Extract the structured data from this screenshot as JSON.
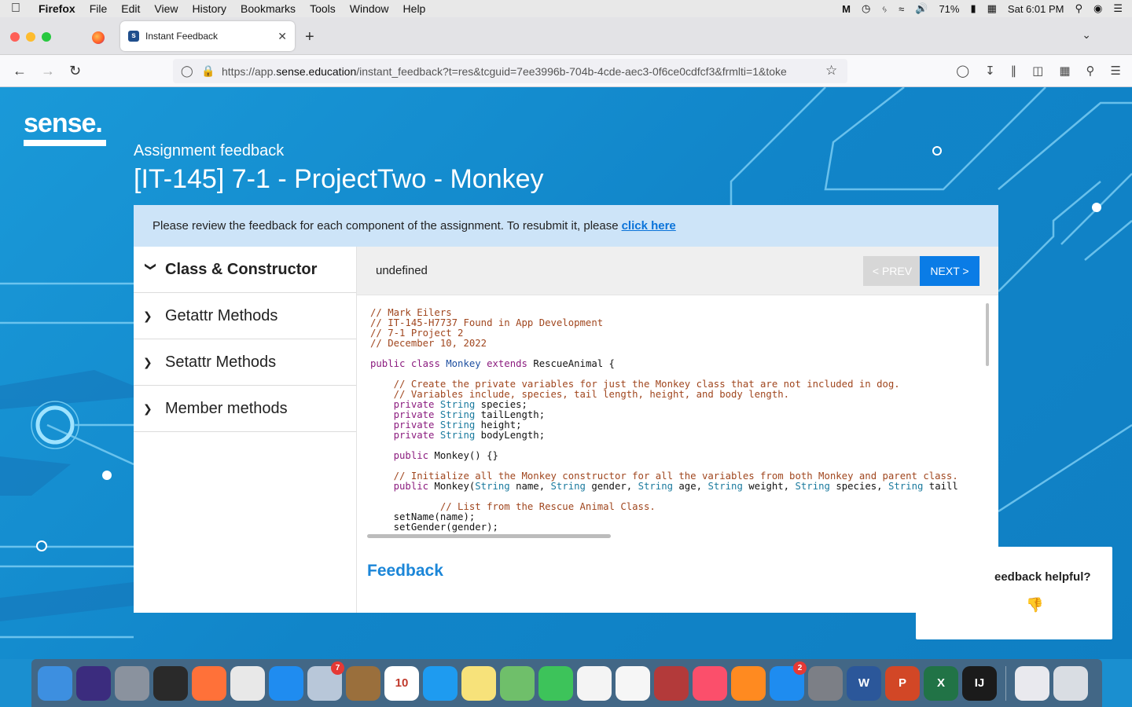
{
  "menubar": {
    "items": [
      "Firefox",
      "File",
      "Edit",
      "View",
      "History",
      "Bookmarks",
      "Tools",
      "Window",
      "Help"
    ],
    "battery": "71%",
    "clock": "Sat 6:01 PM"
  },
  "browser": {
    "tab_title": "Instant Feedback",
    "url_prefix": "https://app.",
    "url_host": "sense.education",
    "url_path": "/instant_feedback?t=res&tcguid=7ee3996b-704b-4cde-aec3-0f6ce0cdfcf3&frmlti=1&toke"
  },
  "page": {
    "subtitle": "Assignment feedback",
    "title": "[IT-145] 7-1 - ProjectTwo - Monkey",
    "notice_text": "Please review the feedback for each component of the assignment. To resubmit it, please",
    "notice_link": "click here",
    "sections": [
      {
        "label": "Class & Constructor",
        "expanded": true
      },
      {
        "label": "Getattr Methods",
        "expanded": false
      },
      {
        "label": "Setattr Methods",
        "expanded": false
      },
      {
        "label": "Member methods",
        "expanded": false
      }
    ],
    "panel_title": "undefined",
    "prev_label": "< PREV",
    "next_label": "NEXT >",
    "feedback_heading": "Feedback",
    "helpful_question": "eedback helpful?"
  },
  "code_lines": [
    [
      {
        "t": "// Mark Eilers",
        "c": "com"
      }
    ],
    [
      {
        "t": "// IT-145-H7737 Found in App Development",
        "c": "com"
      }
    ],
    [
      {
        "t": "// 7-1 Project 2",
        "c": "com"
      }
    ],
    [
      {
        "t": "// December 10, 2022",
        "c": "com"
      }
    ],
    [],
    [
      {
        "t": "public ",
        "c": "kw"
      },
      {
        "t": "class ",
        "c": "kw"
      },
      {
        "t": "Monkey ",
        "c": "cls"
      },
      {
        "t": "extends ",
        "c": "kw"
      },
      {
        "t": "RescueAnimal {",
        "c": ""
      }
    ],
    [],
    [
      {
        "t": "    // Create the private variables for just the Monkey class that are not included in dog.",
        "c": "com"
      }
    ],
    [
      {
        "t": "    // Variables include, species, tail length, height, and body length.",
        "c": "com"
      }
    ],
    [
      {
        "t": "    private ",
        "c": "kw"
      },
      {
        "t": "String ",
        "c": "ty"
      },
      {
        "t": "species;",
        "c": ""
      }
    ],
    [
      {
        "t": "    private ",
        "c": "kw"
      },
      {
        "t": "String ",
        "c": "ty"
      },
      {
        "t": "tailLength;",
        "c": ""
      }
    ],
    [
      {
        "t": "    private ",
        "c": "kw"
      },
      {
        "t": "String ",
        "c": "ty"
      },
      {
        "t": "height;",
        "c": ""
      }
    ],
    [
      {
        "t": "    private ",
        "c": "kw"
      },
      {
        "t": "String ",
        "c": "ty"
      },
      {
        "t": "bodyLength;",
        "c": ""
      }
    ],
    [],
    [
      {
        "t": "    public ",
        "c": "kw"
      },
      {
        "t": "Monkey() {}",
        "c": ""
      }
    ],
    [],
    [
      {
        "t": "    // Initialize all the Monkey constructor for all the variables from both Monkey and parent class.",
        "c": "com"
      }
    ],
    [
      {
        "t": "    public ",
        "c": "kw"
      },
      {
        "t": "Monkey(",
        "c": ""
      },
      {
        "t": "String ",
        "c": "ty"
      },
      {
        "t": "name, ",
        "c": ""
      },
      {
        "t": "String ",
        "c": "ty"
      },
      {
        "t": "gender, ",
        "c": ""
      },
      {
        "t": "String ",
        "c": "ty"
      },
      {
        "t": "age, ",
        "c": ""
      },
      {
        "t": "String ",
        "c": "ty"
      },
      {
        "t": "weight, ",
        "c": ""
      },
      {
        "t": "String ",
        "c": "ty"
      },
      {
        "t": "species, ",
        "c": ""
      },
      {
        "t": "String ",
        "c": "ty"
      },
      {
        "t": "taill",
        "c": ""
      }
    ],
    [],
    [
      {
        "t": "            // List from the Rescue Animal Class.",
        "c": "com"
      }
    ],
    [
      {
        "t": "    setName(name);",
        "c": ""
      }
    ],
    [
      {
        "t": "    setGender(gender);",
        "c": ""
      }
    ]
  ],
  "dock": {
    "apps": [
      {
        "name": "Finder",
        "color": "#3d8fe0",
        "glyph": ""
      },
      {
        "name": "Siri",
        "color": "#3b2c7e",
        "glyph": ""
      },
      {
        "name": "Launchpad",
        "color": "#8a929e",
        "glyph": ""
      },
      {
        "name": "Kaleidoscope",
        "color": "#2a2a2a",
        "glyph": ""
      },
      {
        "name": "Firefox",
        "color": "#ff7139",
        "glyph": ""
      },
      {
        "name": "Chrome",
        "color": "#e8e8e8",
        "glyph": ""
      },
      {
        "name": "Safari",
        "color": "#1f8cf0",
        "glyph": ""
      },
      {
        "name": "Mail",
        "color": "#b8c7d9",
        "glyph": "",
        "badge": "7"
      },
      {
        "name": "Notefile",
        "color": "#9a6f3c",
        "glyph": ""
      },
      {
        "name": "Calendar",
        "color": "#ffffff",
        "glyph": "10"
      },
      {
        "name": "Messages",
        "color": "#1e9bf0",
        "glyph": ""
      },
      {
        "name": "Notes",
        "color": "#f7e27a",
        "glyph": ""
      },
      {
        "name": "Maps",
        "color": "#6fbf6a",
        "glyph": ""
      },
      {
        "name": "FaceTime",
        "color": "#3dc35a",
        "glyph": ""
      },
      {
        "name": "Reminders",
        "color": "#f4f4f4",
        "glyph": ""
      },
      {
        "name": "Photos",
        "color": "#f6f6f6",
        "glyph": ""
      },
      {
        "name": "Photo Booth",
        "color": "#b33a3a",
        "glyph": ""
      },
      {
        "name": "Music",
        "color": "#fb4f6b",
        "glyph": ""
      },
      {
        "name": "Books",
        "color": "#ff8a20",
        "glyph": ""
      },
      {
        "name": "App Store",
        "color": "#1e8cf0",
        "glyph": "",
        "badge": "2"
      },
      {
        "name": "System Preferences",
        "color": "#7c7f86",
        "glyph": ""
      },
      {
        "name": "Word",
        "color": "#2b579a",
        "glyph": "W"
      },
      {
        "name": "PowerPoint",
        "color": "#d24726",
        "glyph": "P"
      },
      {
        "name": "Excel",
        "color": "#217346",
        "glyph": "X"
      },
      {
        "name": "IntelliJ IDEA",
        "color": "#1b1b1b",
        "glyph": "IJ"
      }
    ],
    "extras": [
      {
        "name": "Downloads",
        "color": "#e9e9ee",
        "glyph": ""
      },
      {
        "name": "Trash",
        "color": "#d9dde3",
        "glyph": ""
      }
    ]
  }
}
